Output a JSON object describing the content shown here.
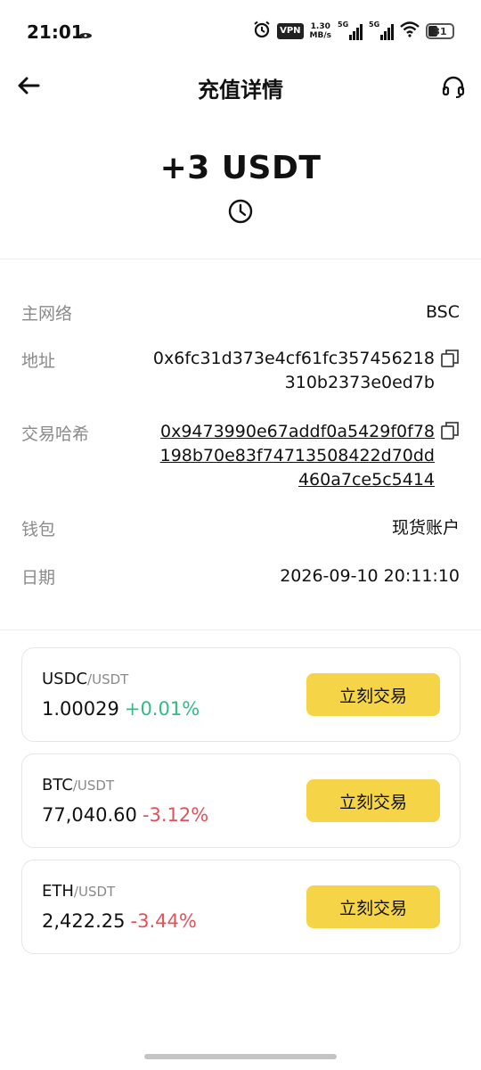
{
  "status_bar": {
    "time": "21:01",
    "vpn": "VPN",
    "speed_value": "1.30",
    "speed_unit": "MB/s",
    "sim1": "5G",
    "sim2": "5G",
    "battery": "31",
    "icons": [
      "alarm-icon",
      "vpn-icon",
      "signal-icon",
      "wifi-icon",
      "battery-icon"
    ]
  },
  "header": {
    "title": "充值详情",
    "back_icon": "arrow-left-icon",
    "support_icon": "headset-icon"
  },
  "amount": {
    "text": "+3 USDT",
    "status_icon": "clock-icon"
  },
  "details": {
    "network_label": "主网络",
    "network_value": "BSC",
    "address_label": "地址",
    "address_value": "0x6fc31d373e4cf61fc357456218310b2373e0ed7b",
    "hash_label": "交易哈希",
    "hash_value": "0x9473990e67addf0a5429f0f78198b70e83f74713508422d70dd460a7ce5c5414",
    "wallet_label": "钱包",
    "wallet_value": "现货账户",
    "date_label": "日期",
    "date_value": "2026-09-10 20:11:10",
    "copy_icon": "copy-icon"
  },
  "markets": [
    {
      "base": "USDC",
      "quote": "/USDT",
      "price": "1.00029",
      "change": "+0.01%",
      "direction": "up",
      "button": "立刻交易"
    },
    {
      "base": "BTC",
      "quote": "/USDT",
      "price": "77,040.60",
      "change": "-3.12%",
      "direction": "down",
      "button": "立刻交易"
    },
    {
      "base": "ETH",
      "quote": "/USDT",
      "price": "2,422.25",
      "change": "-3.44%",
      "direction": "down",
      "button": "立刻交易"
    }
  ],
  "colors": {
    "up": "#2ebd85",
    "down": "#e0525c",
    "accent": "#f5d547"
  }
}
